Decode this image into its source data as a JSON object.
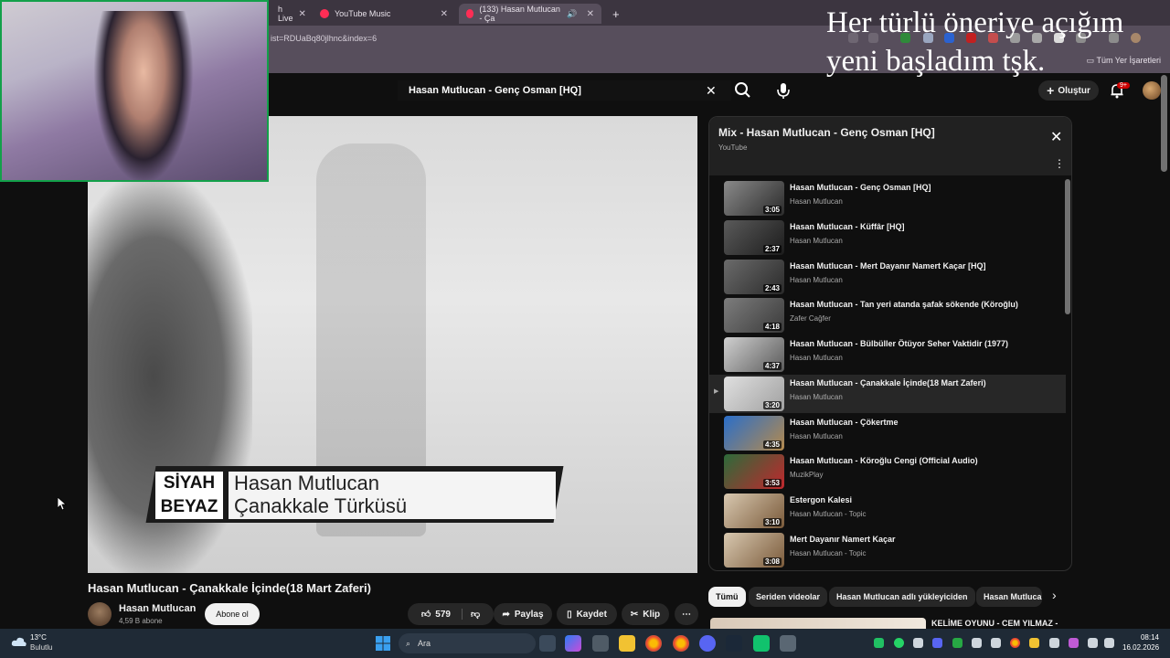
{
  "browser": {
    "tabs": [
      {
        "label": "h Live"
      },
      {
        "label": "YouTube Music"
      },
      {
        "label": "(133) Hasan Mutlucan - Ça"
      }
    ],
    "url": "ist=RDUaBq80jlhnc&index=6",
    "bookmarks_all": "Tüm Yer İşaretleri"
  },
  "overlay": {
    "text": "Her türlü öneriye açığım\nyeni başladım tşk."
  },
  "header": {
    "search_value": "Hasan Mutlucan - Genç Osman [HQ]",
    "create_label": "Oluştur",
    "notif_count": "9+"
  },
  "player": {
    "tag_line1": "SİYAH",
    "tag_line2": "BEYAZ",
    "caption_line1": "Hasan Mutlucan",
    "caption_line2": "Çanakkale Türküsü"
  },
  "video": {
    "title": "Hasan Mutlucan - Çanakkale İçinde(18 Mart Zaferi)",
    "channel": "Hasan Mutlucan",
    "subscribers": "4,59 B abone",
    "subscribe_label": "Abone ol",
    "likes": "579",
    "share_label": "Paylaş",
    "save_label": "Kaydet",
    "clip_label": "Klip"
  },
  "playlist": {
    "title": "Mix - Hasan Mutlucan - Genç Osman [HQ]",
    "subtitle": "YouTube",
    "items": [
      {
        "title": "Hasan Mutlucan - Genç Osman [HQ]",
        "channel": "Hasan Mutlucan",
        "duration": "3:05"
      },
      {
        "title": "Hasan Mutlucan - Küffâr [HQ]",
        "channel": "Hasan Mutlucan",
        "duration": "2:37"
      },
      {
        "title": "Hasan Mutlucan - Mert Dayanır Namert Kaçar [HQ]",
        "channel": "Hasan Mutlucan",
        "duration": "2:43"
      },
      {
        "title": "Hasan Mutlucan - Tan yeri atanda şafak sökende (Köroğlu)",
        "channel": "Zafer Cağfer",
        "duration": "4:18"
      },
      {
        "title": "Hasan Mutlucan - Bülbüller Ötüyor Seher Vaktidir (1977)",
        "channel": "Hasan Mutlucan",
        "duration": "4:37"
      },
      {
        "title": "Hasan Mutlucan - Çanakkale İçinde(18 Mart Zaferi)",
        "channel": "Hasan Mutlucan",
        "duration": "3:20"
      },
      {
        "title": "Hasan Mutlucan - Çökertme",
        "channel": "Hasan Mutlucan",
        "duration": "4:35"
      },
      {
        "title": "Hasan Mutlucan - Köroğlu Cengi (Official Audio)",
        "channel": "MuzikPlay",
        "duration": "3:53"
      },
      {
        "title": "Estergon Kalesi",
        "channel": "Hasan Mutlucan - Topic",
        "duration": "3:10"
      },
      {
        "title": "Mert Dayanır Namert Kaçar",
        "channel": "Hasan Mutlucan - Topic",
        "duration": "3:08"
      }
    ],
    "current_index": 5
  },
  "chips": [
    "Tümü",
    "Seriden videolar",
    "Hasan Mutlucan adlı yükleyiciden",
    "Hasan Mutluca"
  ],
  "recommendation": {
    "title": "KELİME OYUNU - CEM YILMAZ -"
  },
  "taskbar": {
    "temperature": "13°C",
    "weather": "Bulutlu",
    "search_label": "Ara",
    "time": "08:14",
    "date": "16.02.2026"
  },
  "colors": {
    "background": "#0f0f0f",
    "surface": "#272727",
    "accent_red": "#ff0000",
    "webcam_border": "#13a04a"
  }
}
